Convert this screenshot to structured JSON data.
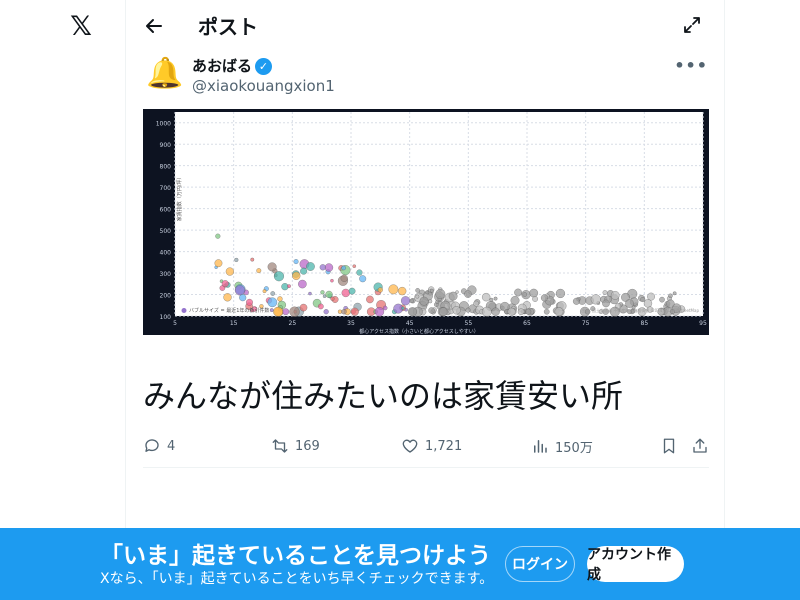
{
  "app": {
    "logo_glyph": "𝕏"
  },
  "header": {
    "title": "ポスト"
  },
  "post": {
    "author": {
      "name": "あおばる",
      "handle": "@xiaokouangxion1",
      "avatar_glyph": "🔔",
      "verified_glyph": "✓"
    },
    "text": "みんなが住みたいのは家賃安い所",
    "image": {
      "legend": "バブルサイズ = 最近1年の新引件数",
      "credit": "出典: 国土交通省 不動産取引価格情報 (2024) / OpenStreetMap"
    }
  },
  "actions": {
    "replies": "4",
    "reposts": "169",
    "likes": "1,721",
    "views": "150万"
  },
  "banner": {
    "title": "「いま」起きていることを見つけよう",
    "subtitle": "Xなら、「いま」起きていることをいち早くチェックできます。",
    "login_label": "ログイン",
    "signup_label": "アカウント作成"
  },
  "chart_data": {
    "type": "scatter",
    "xlabel": "都心アクセス指数（小さいと都心アクセスしやすい）",
    "ylabel": "家賃指数（万円/坪）",
    "x_ticks": [
      5,
      15,
      25,
      35,
      45,
      55,
      65,
      75,
      85,
      95
    ],
    "y_ticks": [
      100,
      200,
      300,
      400,
      500,
      600,
      700,
      800,
      900,
      1000
    ],
    "xlim": [
      5,
      95
    ],
    "ylim": [
      100,
      1050
    ],
    "grid": true,
    "legend": "bottom-left"
  }
}
